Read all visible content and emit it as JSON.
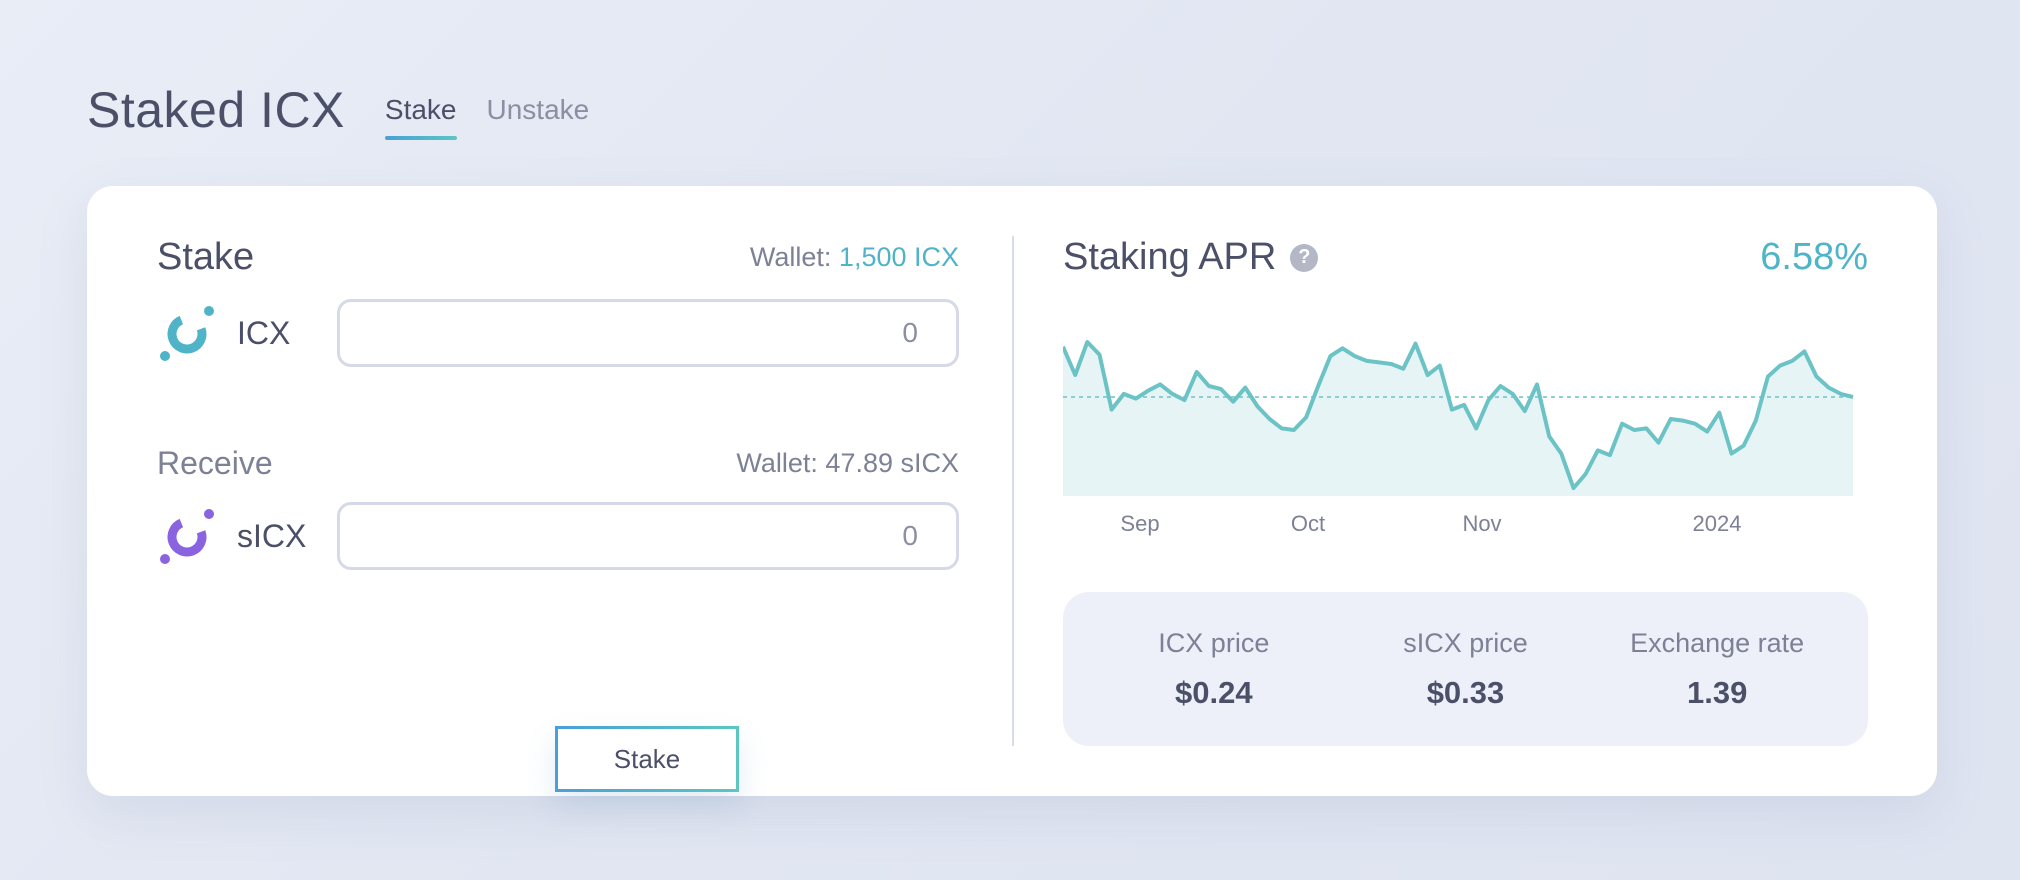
{
  "page": {
    "title": "Staked ICX",
    "tabs": [
      {
        "label": "Stake",
        "active": true
      },
      {
        "label": "Unstake",
        "active": false
      }
    ]
  },
  "stake_panel": {
    "title": "Stake",
    "wallet_prefix": "Wallet:",
    "wallet_amount": "1,500 ICX",
    "input_token": "ICX",
    "input_placeholder": "0",
    "receive_title": "Receive",
    "receive_wallet": "Wallet: 47.89 sICX",
    "output_token": "sICX",
    "output_placeholder": "0",
    "button_label": "Stake"
  },
  "apr_panel": {
    "title": "Staking APR",
    "help_glyph": "?",
    "value": "6.58%",
    "stats": [
      {
        "label": "ICX price",
        "value": "$0.24"
      },
      {
        "label": "sICX price",
        "value": "$0.33"
      },
      {
        "label": "Exchange rate",
        "value": "1.39"
      }
    ]
  },
  "chart_data": {
    "type": "area",
    "x_ticks": [
      "Sep",
      "Oct",
      "Nov",
      "2024"
    ],
    "series": [
      {
        "values": [
          6.9,
          6.72,
          6.93,
          6.85,
          6.5,
          6.6,
          6.57,
          6.62,
          6.66,
          6.6,
          6.56,
          6.74,
          6.65,
          6.63,
          6.55,
          6.64,
          6.52,
          6.44,
          6.38,
          6.37,
          6.45,
          6.65,
          6.84,
          6.89,
          6.84,
          6.81,
          6.8,
          6.79,
          6.76,
          6.92,
          6.72,
          6.78,
          6.5,
          6.53,
          6.38,
          6.56,
          6.65,
          6.6,
          6.49,
          6.66,
          6.33,
          6.22,
          6.0,
          6.09,
          6.24,
          6.21,
          6.41,
          6.37,
          6.38,
          6.29,
          6.44,
          6.43,
          6.41,
          6.36,
          6.48,
          6.22,
          6.27,
          6.43,
          6.71,
          6.78,
          6.81,
          6.87,
          6.71,
          6.64,
          6.6,
          6.58
        ]
      }
    ],
    "reference_value": 6.58,
    "colors": {
      "line": "#6cc3c6",
      "fill": "#e6f4f6",
      "reference": "#6cc3c6"
    }
  },
  "colors": {
    "accent": "#4fb4c8",
    "icx_icon": "#4fb4c8",
    "sicx_icon": "#8a63e0",
    "text": "#4b5068",
    "muted": "#7c8196"
  }
}
